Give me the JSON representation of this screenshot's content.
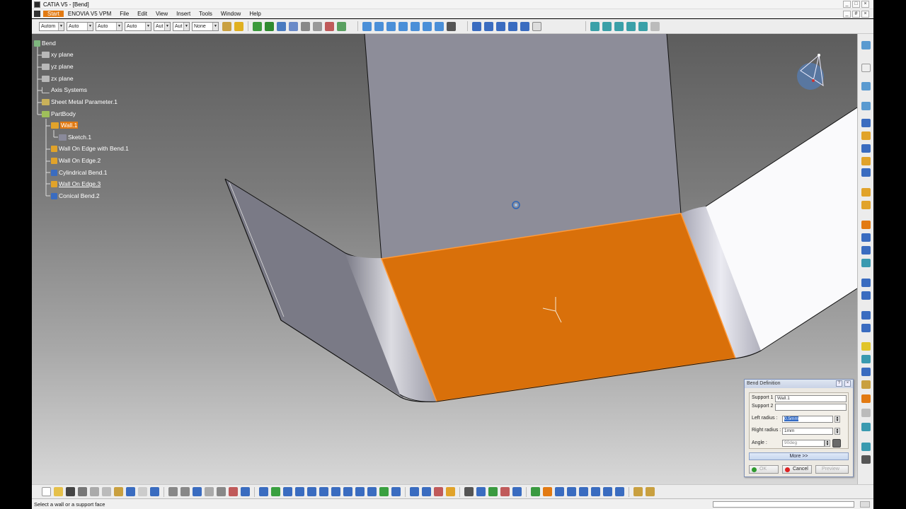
{
  "window": {
    "title": "CATIA V5 - [Bend]",
    "buttons": [
      "_",
      "□",
      "×"
    ],
    "mdi_buttons": [
      "_",
      "#",
      "×"
    ]
  },
  "menubar": {
    "items": [
      "Start",
      "ENOVIA V5 VPM",
      "File",
      "Edit",
      "View",
      "Insert",
      "Tools",
      "Window",
      "Help"
    ]
  },
  "toolbar_top": {
    "combos": [
      "Autom",
      "Auto",
      "Auto",
      "Auto",
      "Aut",
      "Aut",
      "None"
    ]
  },
  "tree": {
    "root": "Bend",
    "nodes": [
      {
        "label": "xy plane"
      },
      {
        "label": "yz plane"
      },
      {
        "label": "zx plane"
      },
      {
        "label": "Axis Systems"
      },
      {
        "label": "Sheet Metal Parameter.1"
      },
      {
        "label": "PartBody"
      },
      {
        "label": "Wall.1"
      },
      {
        "label": "Sketch.1"
      },
      {
        "label": "Wall On Edge with Bend.1"
      },
      {
        "label": "Wall On Edge.2"
      },
      {
        "label": "Cylindrical Bend.1"
      },
      {
        "label": "Wall On Edge.3"
      },
      {
        "label": "Conical Bend.2"
      }
    ]
  },
  "dialog": {
    "title": "Bend Definition",
    "support1_label": "Support 1 :",
    "support1_value": "Wall.1",
    "support2_label": "Support 2 :",
    "support2_value": "",
    "left_radius_label": "Left radius :",
    "left_radius_value": "0.5mm",
    "right_radius_label": "Right radius :",
    "right_radius_value": "1mm",
    "angle_label": "Angle :",
    "angle_value": "90deg",
    "more_label": "More >>",
    "ok_label": "OK",
    "cancel_label": "Cancel",
    "preview_label": "Preview"
  },
  "status": {
    "message": "Select a wall or a support face"
  },
  "colors": {
    "selection": "#e27a12",
    "face_orange": "#d9700a",
    "sheet_gray": "#8d8d99",
    "dialog_bg": "#ece9e2"
  }
}
